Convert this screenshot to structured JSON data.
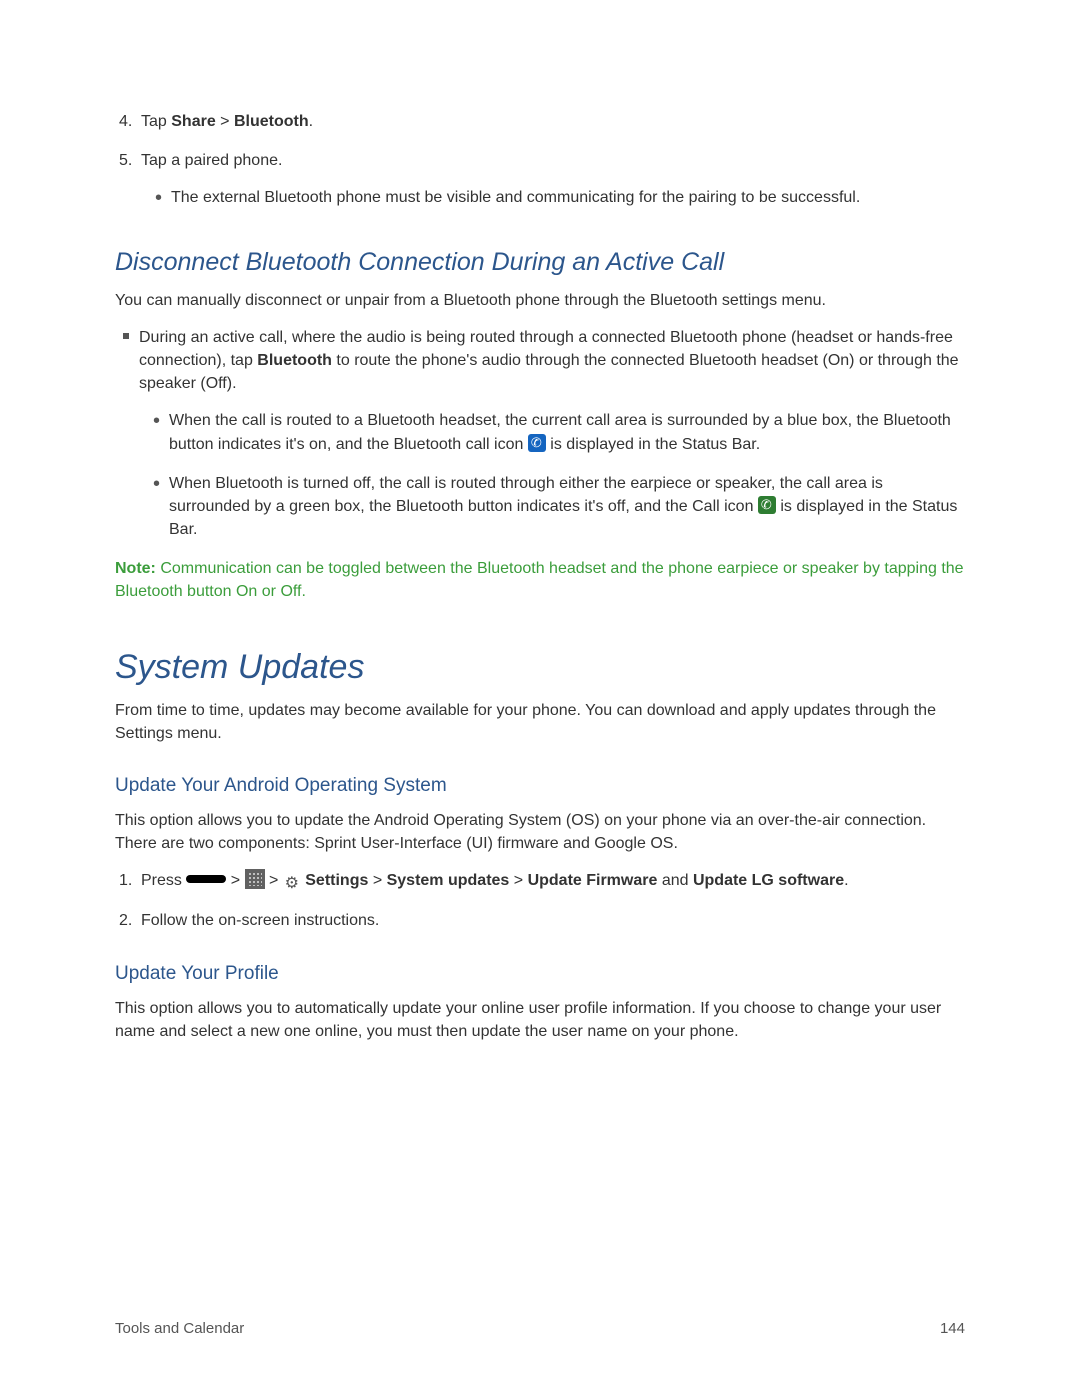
{
  "step4": {
    "prefix": "Tap ",
    "share": "Share",
    "sep": " > ",
    "bluetooth": "Bluetooth",
    "period": "."
  },
  "step5": {
    "text": "Tap a paired phone.",
    "bullet": "The external Bluetooth phone must be visible and communicating for the pairing to be successful."
  },
  "disconnect": {
    "heading": "Disconnect Bluetooth Connection During an Active Call",
    "body": "You can manually disconnect or unpair from a Bluetooth phone through the Bluetooth settings menu.",
    "sq_pre": "During an active call, where the audio is being routed through a connected Bluetooth phone (headset or hands-free connection), tap ",
    "sq_bold": "Bluetooth",
    "sq_post": " to route the phone's audio through the connected Bluetooth headset (On) or through the speaker (Off).",
    "sub1_pre": "When the call is routed to a Bluetooth headset, the current call area is surrounded by a blue box, the Bluetooth button indicates it's on, and the Bluetooth call icon ",
    "sub1_post": " is displayed in the Status Bar.",
    "sub2_pre": "When Bluetooth is turned off, the call is routed through either the earpiece or speaker, the call area is surrounded by a green box, the Bluetooth button indicates it's off, and the Call icon ",
    "sub2_post": " is displayed in the Status Bar."
  },
  "note": {
    "label": "Note:",
    "text": "  Communication can be toggled between the Bluetooth headset and the phone earpiece or speaker by tapping the Bluetooth button On or Off."
  },
  "updates": {
    "heading": "System Updates",
    "body": "From time to time, updates may become available for your phone. You can download and apply updates through the Settings menu."
  },
  "androidOS": {
    "heading": "Update Your Android Operating System",
    "body": "This option allows you to update the Android Operating System (OS) on your phone via an over-the-air connection. There are two components: Sprint User-Interface (UI) firmware and Google OS.",
    "step1_press": "Press ",
    "step1_gt": " > ",
    "step1_settings": " Settings",
    "step1_sys": "System updates",
    "step1_upd": "Update Firmware",
    "step1_and": " and ",
    "step1_lg": "Update LG software",
    "step1_period": ".",
    "step2": "Follow the on-screen instructions."
  },
  "profile": {
    "heading": "Update Your Profile",
    "body": "This option allows you to automatically update your online user profile information. If you choose to change your user name and select a new one online, you must then update the user name on your phone."
  },
  "footer": {
    "left": "Tools and Calendar",
    "right": "144"
  }
}
